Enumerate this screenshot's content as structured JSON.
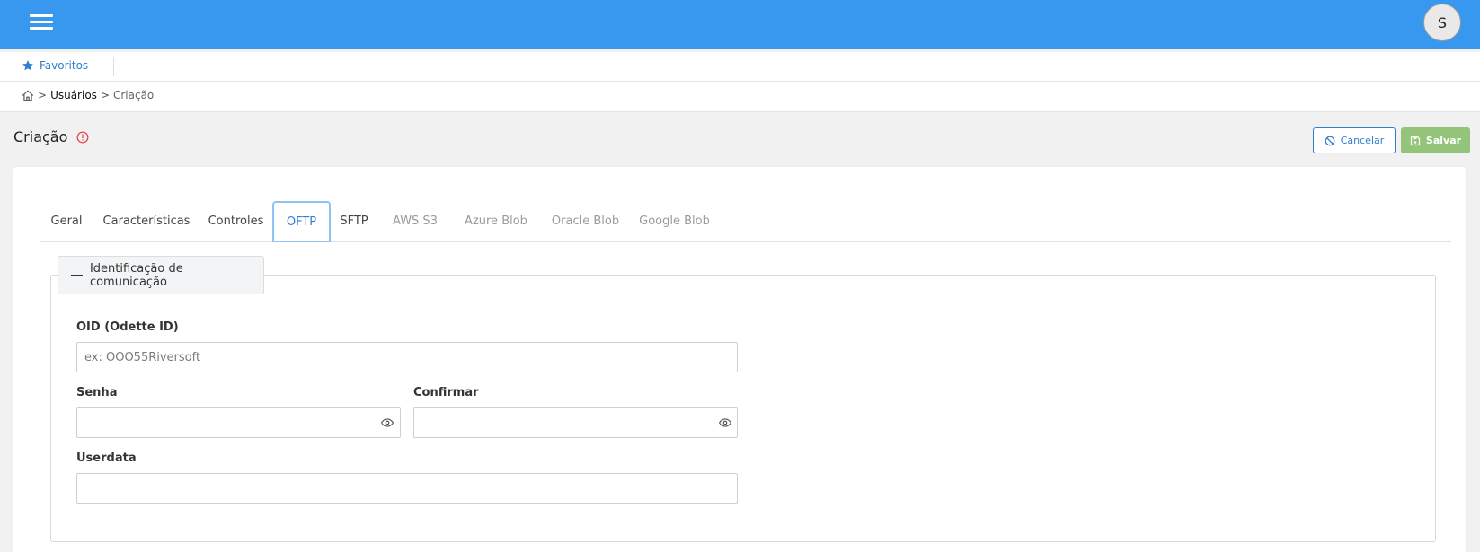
{
  "topbar": {
    "avatar_letter": "S",
    "menu_icon": "hamburger-menu-icon",
    "color": "#3897ee"
  },
  "favorites": {
    "label": "Favoritos",
    "icon": "star-icon"
  },
  "breadcrumb": {
    "home_icon": "home-icon",
    "separator": ">",
    "items": [
      "Usuários",
      "Criação"
    ]
  },
  "page": {
    "title": "Criação",
    "status_icon": "warning-circle-icon"
  },
  "actions": {
    "cancel_label": "Cancelar",
    "save_label": "Salvar"
  },
  "tabs": [
    {
      "label": "Geral",
      "state": "normal"
    },
    {
      "label": "Características",
      "state": "normal"
    },
    {
      "label": "Controles",
      "state": "normal"
    },
    {
      "label": "OFTP",
      "state": "active"
    },
    {
      "label": "SFTP",
      "state": "normal"
    },
    {
      "label": "AWS S3",
      "state": "disabled"
    },
    {
      "label": "Azure Blob",
      "state": "disabled"
    },
    {
      "label": "Oracle Blob",
      "state": "disabled"
    },
    {
      "label": "Google Blob",
      "state": "disabled"
    }
  ],
  "section": {
    "title": "Identificação de comunicação",
    "fields": {
      "oid": {
        "label": "OID (Odette ID)",
        "placeholder": "ex: OOO55Riversoft",
        "value": ""
      },
      "senha": {
        "label": "Senha",
        "value": ""
      },
      "confirmar": {
        "label": "Confirmar",
        "value": ""
      },
      "userdata": {
        "label": "Userdata",
        "value": ""
      }
    }
  },
  "colors": {
    "accent": "#2f7fd1",
    "save": "#93c47a",
    "warning": "#e5393b"
  }
}
